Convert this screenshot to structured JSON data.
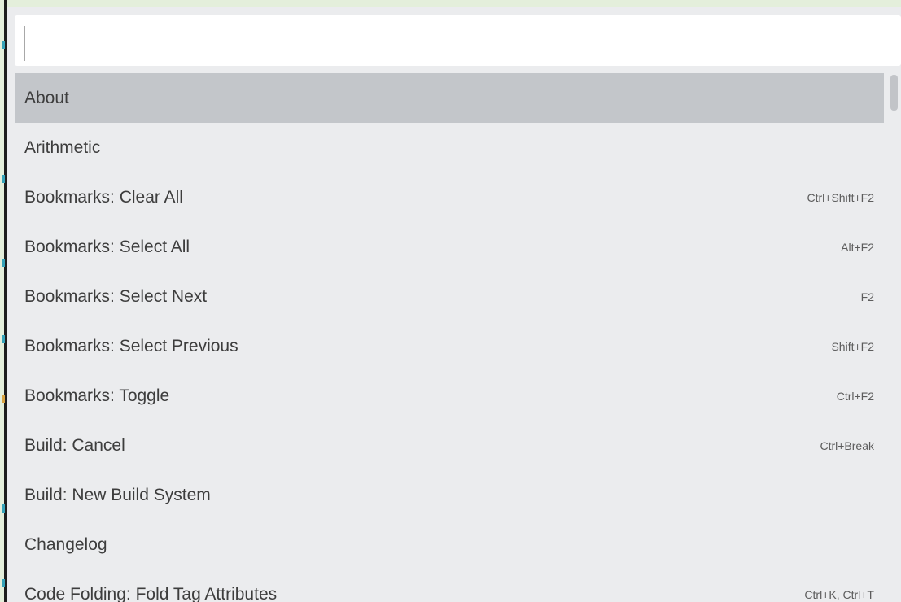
{
  "search": {
    "value": "",
    "placeholder": ""
  },
  "commands": [
    {
      "label": "About",
      "shortcut": "",
      "selected": true
    },
    {
      "label": "Arithmetic",
      "shortcut": ""
    },
    {
      "label": "Bookmarks: Clear All",
      "shortcut": "Ctrl+Shift+F2"
    },
    {
      "label": "Bookmarks: Select All",
      "shortcut": "Alt+F2"
    },
    {
      "label": "Bookmarks: Select Next",
      "shortcut": "F2"
    },
    {
      "label": "Bookmarks: Select Previous",
      "shortcut": "Shift+F2"
    },
    {
      "label": "Bookmarks: Toggle",
      "shortcut": "Ctrl+F2"
    },
    {
      "label": "Build: Cancel",
      "shortcut": "Ctrl+Break"
    },
    {
      "label": "Build: New Build System",
      "shortcut": ""
    },
    {
      "label": "Changelog",
      "shortcut": ""
    },
    {
      "label": "Code Folding: Fold Tag Attributes",
      "shortcut": "Ctrl+K, Ctrl+T"
    }
  ],
  "colors": {
    "background": "#e4efdb",
    "panel": "#ebecee",
    "selected_row": "#c3c6ca",
    "input_bg": "#ffffff"
  }
}
